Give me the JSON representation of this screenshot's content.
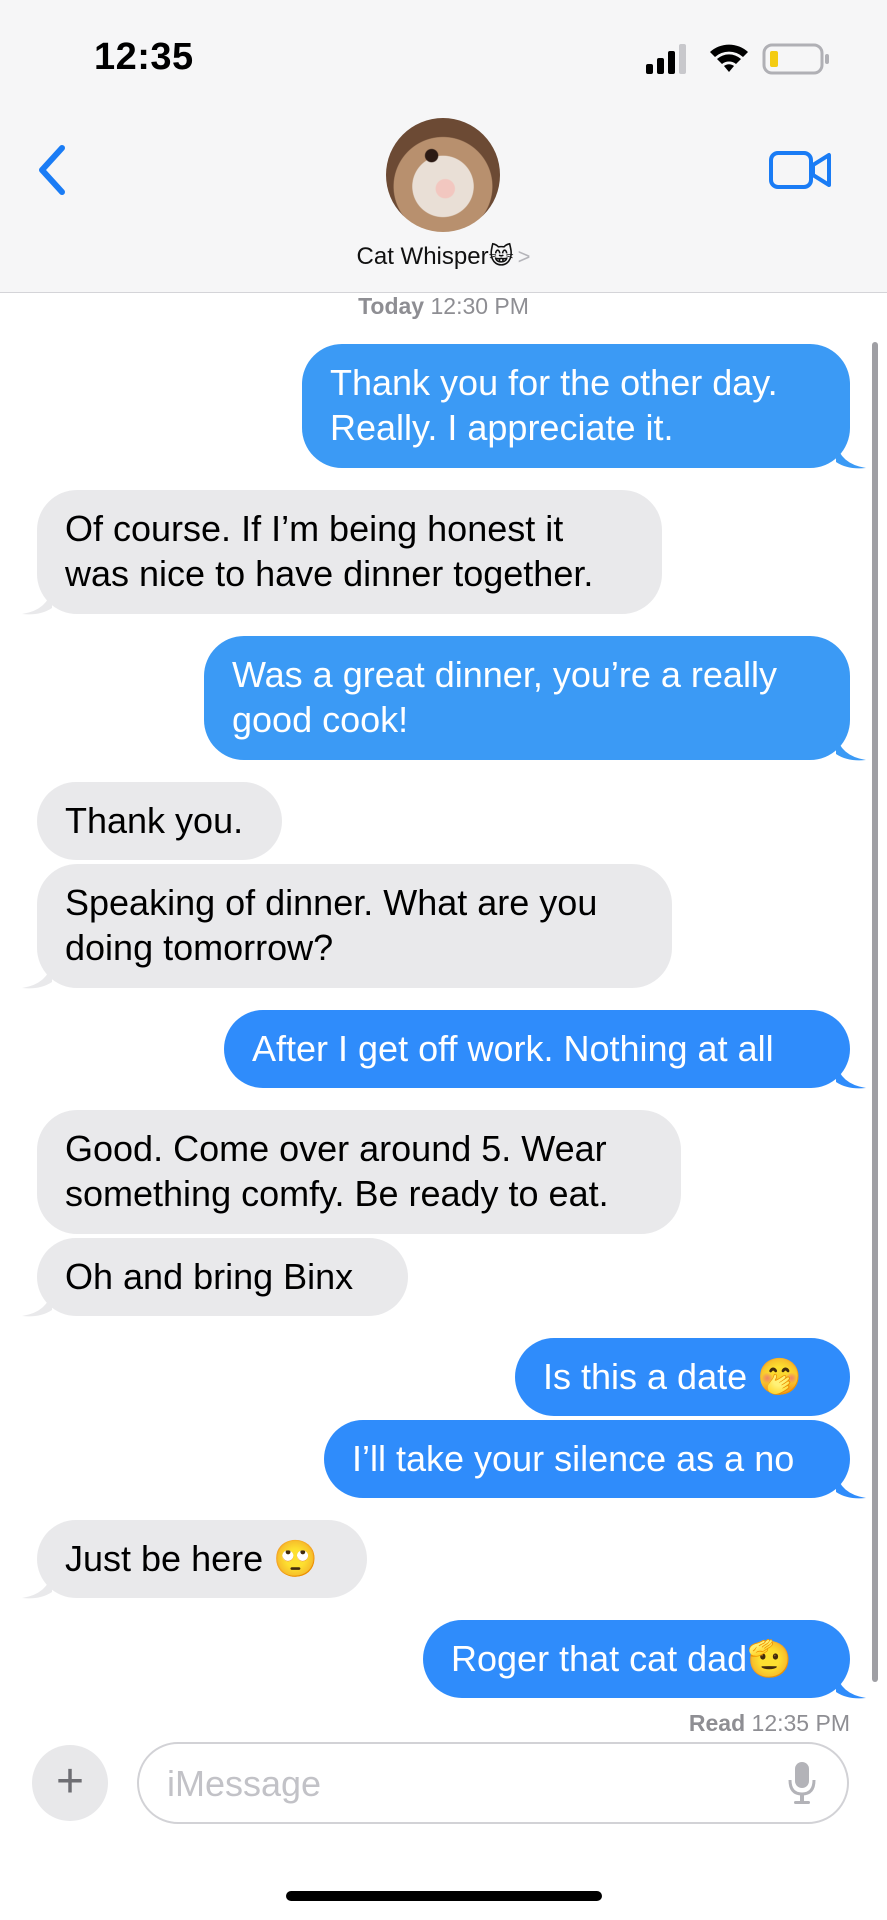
{
  "status_bar": {
    "time": "12:35"
  },
  "header": {
    "contact_name": "Cat Whisper",
    "contact_emoji": "😸",
    "contact_chevron": ">"
  },
  "thread": {
    "date_label": "Today",
    "date_time": "12:30 PM",
    "messages": [
      {
        "from": "me",
        "text": "Thank you for the other day.\nReally. I appreciate it."
      },
      {
        "from": "them",
        "text": "Of course. If I’m being honest it\nwas nice to have dinner together."
      },
      {
        "from": "me",
        "text": "Was a great dinner, you’re a really\ngood cook!"
      },
      {
        "from": "them",
        "text": "Thank you."
      },
      {
        "from": "them",
        "text": "Speaking of dinner. What are you\ndoing tomorrow?"
      },
      {
        "from": "me",
        "text": "After I get off work. Nothing at all"
      },
      {
        "from": "them",
        "text": "Good. Come over around 5. Wear\nsomething comfy. Be ready to eat."
      },
      {
        "from": "them",
        "text": "Oh and bring Binx"
      },
      {
        "from": "me",
        "text": "Is this a date 🤭"
      },
      {
        "from": "me",
        "text": "I’ll take your silence as a no"
      },
      {
        "from": "them",
        "text": "Just be here 🙄"
      },
      {
        "from": "me",
        "text": "Roger that cat dad🫡"
      }
    ],
    "read_label": "Read",
    "read_time": "12:35 PM"
  },
  "composer": {
    "plus_label": "+",
    "placeholder": "iMessage"
  },
  "colors": {
    "outgoing_bubble": "#2f8cfb",
    "incoming_bubble": "#e9e9eb",
    "accent": "#1a7cf5"
  }
}
